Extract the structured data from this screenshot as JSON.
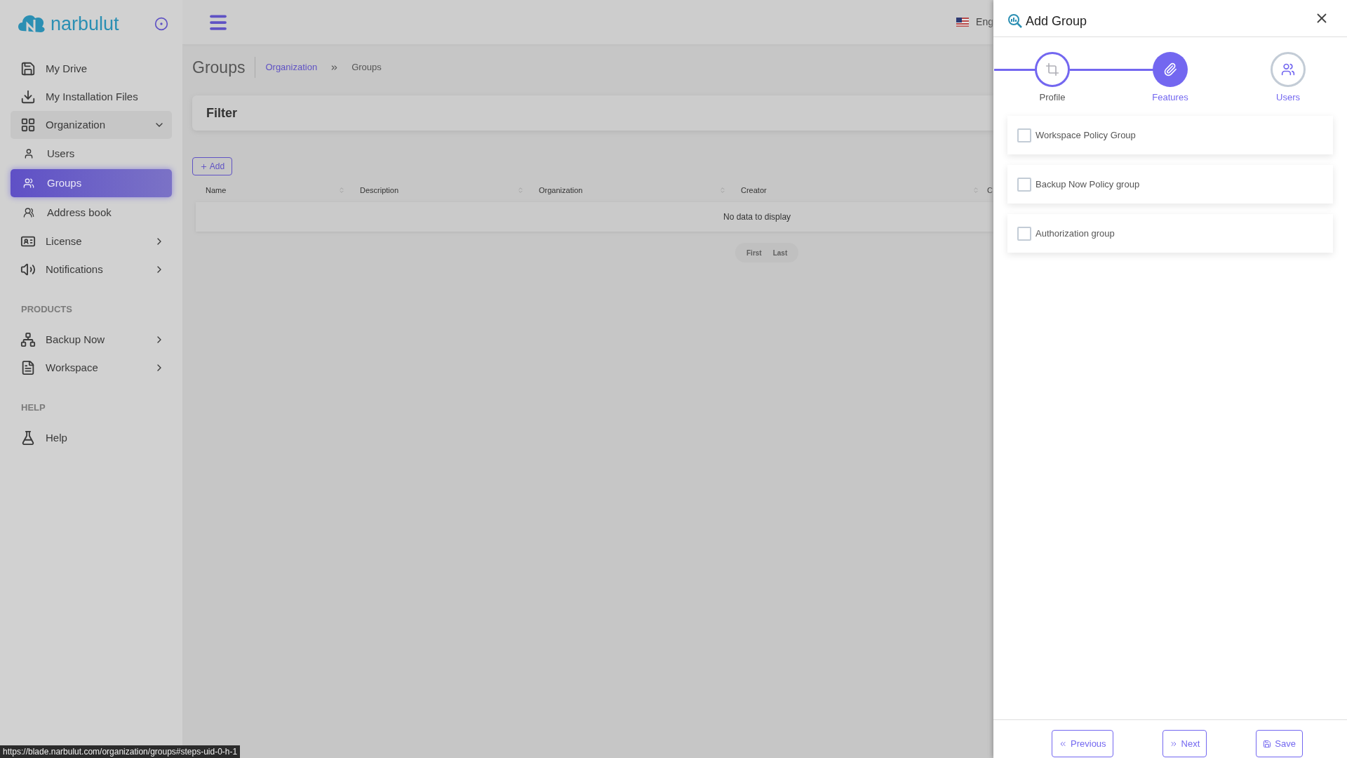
{
  "sidebar": {
    "logo": "narbulut",
    "items": [
      {
        "kind": "link",
        "label": "My Drive"
      },
      {
        "kind": "link",
        "label": "My Installation Files"
      },
      {
        "kind": "group",
        "label": "Organization",
        "expanded": true,
        "children": [
          {
            "label": "Users",
            "selected": false
          },
          {
            "label": "Groups",
            "selected": true
          },
          {
            "label": "Address book",
            "selected": false
          }
        ]
      },
      {
        "kind": "group",
        "label": "License",
        "expanded": false
      },
      {
        "kind": "group",
        "label": "Notifications",
        "expanded": false
      },
      {
        "kind": "heading",
        "label": "PRODUCTS"
      },
      {
        "kind": "group",
        "label": "Backup Now",
        "expanded": false
      },
      {
        "kind": "group",
        "label": "Workspace",
        "expanded": false
      },
      {
        "kind": "heading",
        "label": "HELP"
      },
      {
        "kind": "link",
        "label": "Help"
      }
    ]
  },
  "topbar": {
    "language": "Eng"
  },
  "page": {
    "title": "Groups",
    "breadcrumbs": [
      {
        "label": "Organization",
        "link": true
      },
      {
        "label": "Groups",
        "link": false
      }
    ],
    "filter_title": "Filter",
    "add_button": "Add"
  },
  "table": {
    "columns": [
      "Name",
      "Description",
      "Organization",
      "Creator",
      "C"
    ],
    "empty_text": "No data to display",
    "pagination": [
      "First",
      "Last"
    ]
  },
  "drawer": {
    "title": "Add Group",
    "steps": [
      {
        "label": "Profile",
        "completed": true,
        "selected": false
      },
      {
        "label": "Features",
        "completed": false,
        "selected": true
      },
      {
        "label": "Users",
        "completed": false,
        "selected": false
      }
    ],
    "options": [
      {
        "label": "Workspace Policy Group",
        "checked": false
      },
      {
        "label": "Backup Now Policy group",
        "checked": false
      },
      {
        "label": "Authorization group",
        "checked": false
      }
    ],
    "buttons": [
      {
        "kind": "previous",
        "label": "Previous"
      },
      {
        "kind": "next",
        "label": "Next"
      },
      {
        "kind": "save",
        "label": "Save"
      }
    ]
  },
  "status_url": "https://blade.narbulut.com/organization/groups#steps-uid-0-h-1"
}
